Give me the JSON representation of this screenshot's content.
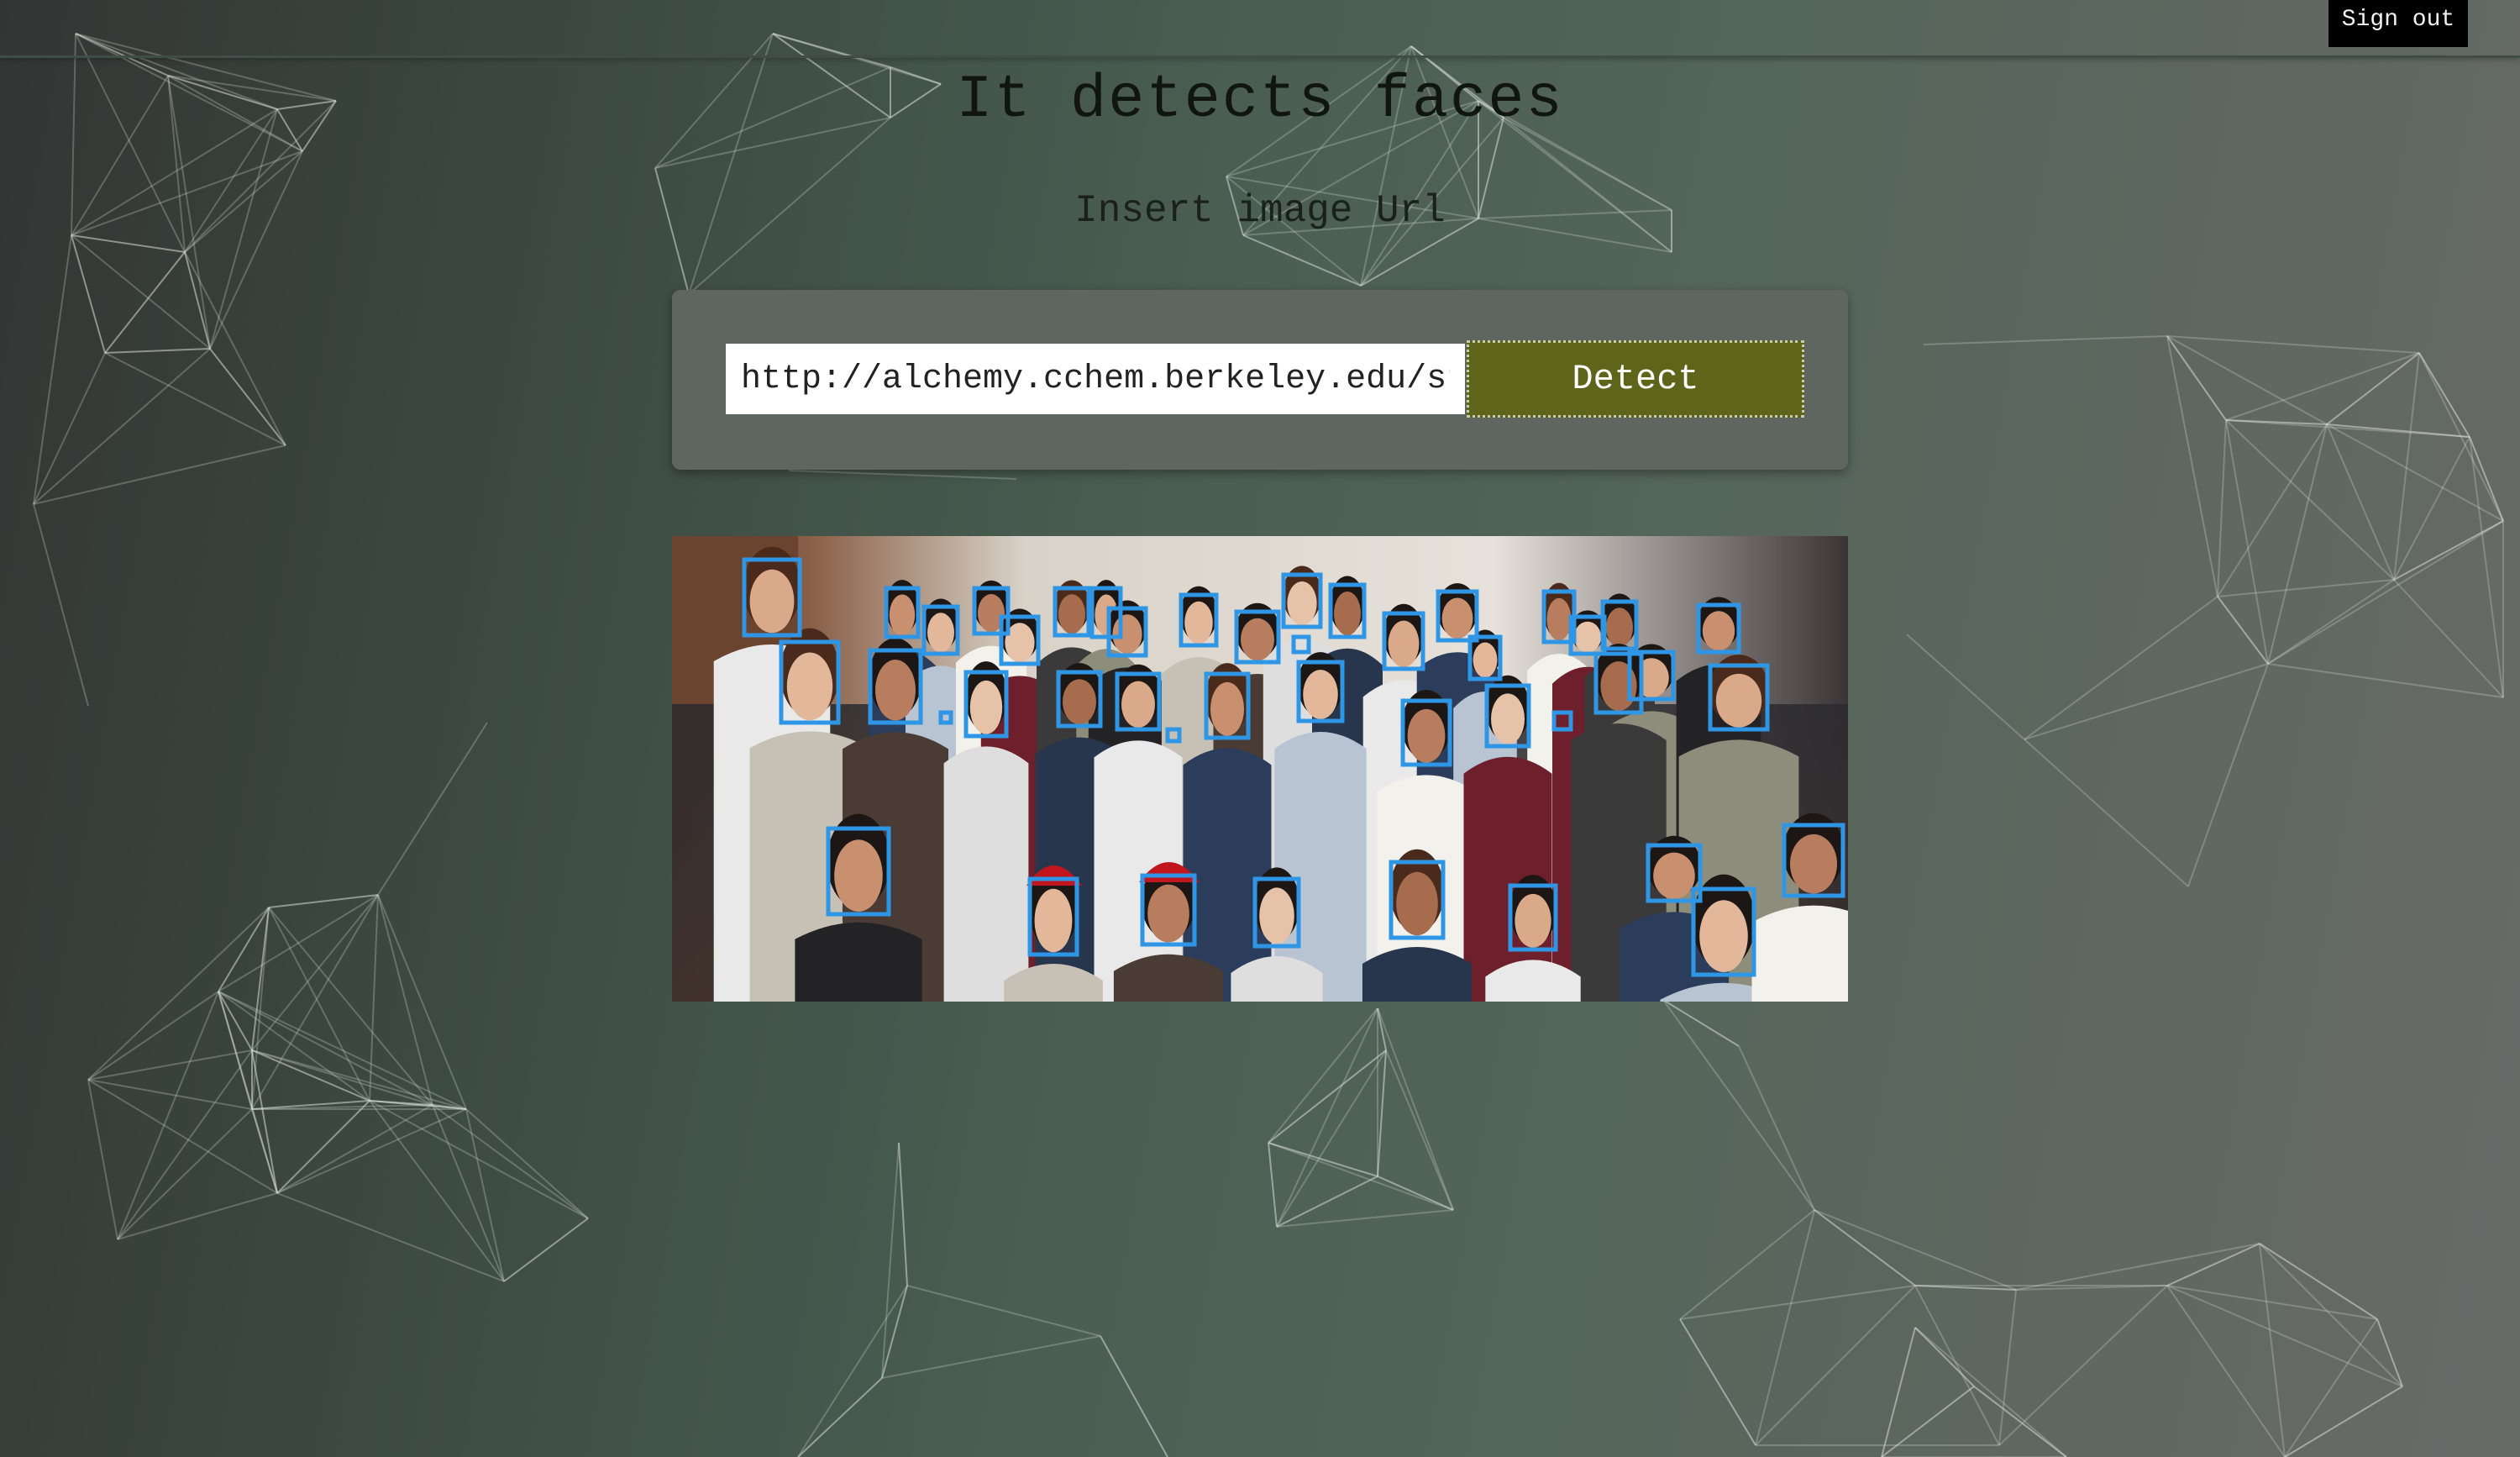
{
  "header": {
    "sign_out_label": "Sign out"
  },
  "main": {
    "title": "It detects faces",
    "subtitle": "Insert image Url",
    "url_input_value": "http://alchemy.cchem.berkeley.edu/static/img/group.jpg",
    "detect_label": "Detect"
  },
  "result": {
    "face_count": 44,
    "box_color": "#2f96e6"
  },
  "colors": {
    "sign_out_bg": "#000000",
    "detect_bg": "#5e6419",
    "panel_bg": "#5f655f"
  }
}
